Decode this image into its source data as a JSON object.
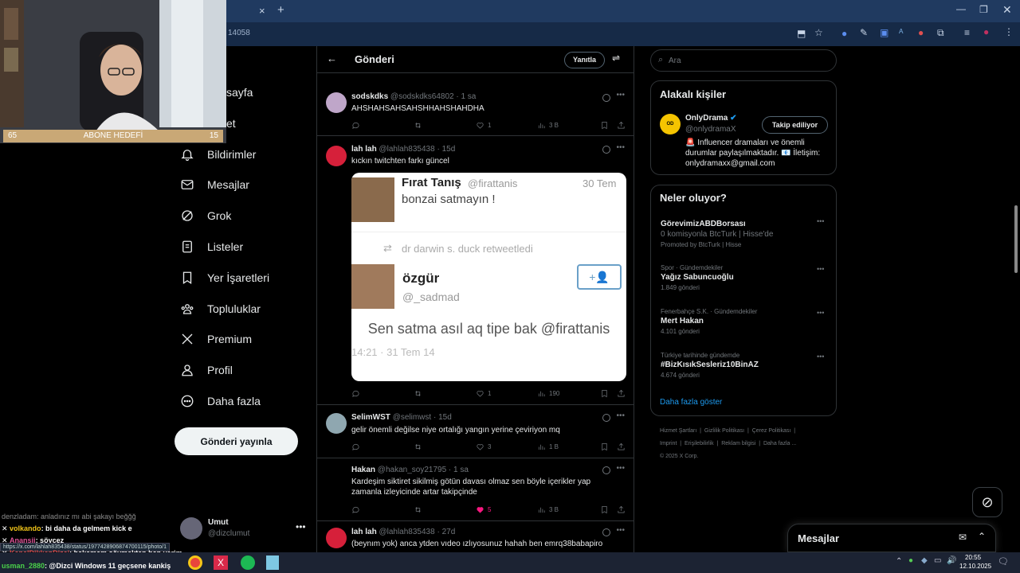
{
  "browser": {
    "url_fragment": "14058",
    "new_tab_symbol": "+",
    "close_symbol": "×"
  },
  "stream": {
    "goal_left": "65",
    "goal_label": "ABONE HEDEFİ",
    "goal_right": "15"
  },
  "sidebar": {
    "items": [
      {
        "label": "sayfa",
        "icon": "home-icon"
      },
      {
        "label": "et",
        "icon": "search-icon"
      },
      {
        "label": "Bildirimler",
        "icon": "bell-icon"
      },
      {
        "label": "Mesajlar",
        "icon": "mail-icon"
      },
      {
        "label": "Grok",
        "icon": "grok-icon"
      },
      {
        "label": "Listeler",
        "icon": "list-icon"
      },
      {
        "label": "Yer İşaretleri",
        "icon": "bookmark-icon"
      },
      {
        "label": "Topluluklar",
        "icon": "communities-icon"
      },
      {
        "label": "Premium",
        "icon": "x-logo-icon"
      },
      {
        "label": "Profil",
        "icon": "profile-icon"
      },
      {
        "label": "Daha fazla",
        "icon": "more-circle-icon"
      }
    ],
    "post_button": "Gönderi yayınla",
    "account_name": "Umut",
    "account_handle": "@dizclumut"
  },
  "header": {
    "title": "Gönderi",
    "reply_button": "Yanıtla"
  },
  "tweets": [
    {
      "name": "sodskdks",
      "handle": "@sodskdks64802",
      "time": "· 1 sa",
      "text": "AHSHAHSAHSAHSHHAHSHAHDHA",
      "likes": "1",
      "views": "3 B",
      "replies": "",
      "retweets": ""
    },
    {
      "name": "lah lah",
      "handle": "@lahlah835438",
      "time": "· 15d",
      "text": "kıckın twitchten farkı güncel",
      "likes": "1",
      "views": "190",
      "embed": {
        "name1": "Fırat Tanış",
        "handle1": "@firattanis",
        "date1": "30 Tem",
        "text1": "bonzai satmayın !",
        "retweet_line": "dr darwin s. duck retweetledi",
        "name2": "özgür",
        "handle2": "@_sadmad",
        "text2": "Sen satma asıl aq tipe bak @firattanis",
        "timestamp": "14:21 · 31 Tem 14"
      }
    },
    {
      "name": "SelimWST",
      "handle": "@selimwst",
      "time": "· 15d",
      "text": "gelir önemli değilse niye ortalığı yangın yerine çeviriyon mq",
      "likes": "3",
      "views": "1 B"
    },
    {
      "name": "Hakan",
      "handle": "@hakan_soy21795",
      "time": "· 1 sa",
      "text": "Kardeşim siktiret sikilmiş götün davası olmaz sen böyle içerikler yap zamanla izleyicinde artar takipçinde",
      "likes": "5",
      "views": "3 B"
    },
    {
      "name": "lah lah",
      "handle": "@lahlah835438",
      "time": "· 27d",
      "text": "(beynım yok) anca ytden  vıdeo ızlıyosunuz hahah ben emrq38babapiro"
    }
  ],
  "search": {
    "placeholder": "Ara"
  },
  "related": {
    "title": "Alakalı kişiler",
    "name": "OnlyDrama",
    "handle": "@onlydramaX",
    "follow_button": "Takip ediliyor",
    "bio": "🚨 Influencer dramaları ve önemli durumlar paylaşılmaktadır. 📧 İletişim: onlydramaxx@gmail.com"
  },
  "trends": {
    "title": "Neler oluyor?",
    "items": [
      {
        "meta": "",
        "title": "GörevimizABDBorsası",
        "sub": "0 komisyonla BtcTurk | Hisse'de",
        "count": "Promoted by BtcTurk | Hisse"
      },
      {
        "meta": "Spor · Gündemdekiler",
        "title": "Yağız Sabuncuoğlu",
        "sub": "",
        "count": "1.849 gönderi"
      },
      {
        "meta": "Fenerbahçe S.K. · Gündemdekiler",
        "title": "Mert Hakan",
        "sub": "",
        "count": "4.101 gönderi"
      },
      {
        "meta": "Türkiye tarihinde gündemde",
        "title": "#BizKısıkSesleriz10BinAZ",
        "sub": "",
        "count": "4.674 gönderi"
      }
    ],
    "show_more": "Daha fazla göster"
  },
  "footer": {
    "links": [
      "Hizmet Şartları",
      "Gizlilik Politikası",
      "Çerez Politikası",
      "Imprint",
      "Erişilebilirlik",
      "Reklam bilgisi",
      "Daha fazla ..."
    ],
    "copyright": "© 2025 X Corp."
  },
  "messages_dock": {
    "title": "Mesajlar"
  },
  "chat": [
    {
      "user": "denzladam",
      "text": ": anladınız mı abi şakayı beğğğ",
      "color": "#8a8a8a"
    },
    {
      "user": "volkando",
      "text": ": bi daha da gelmem kick e",
      "color": "#f0c419"
    },
    {
      "user": "Anansii",
      "text": ": söycez",
      "color": "#e0559a"
    },
    {
      "user": "KanalDikkenDizci",
      "text": ": bakamam sövmekten ban yerim",
      "color": "#e04a4a"
    },
    {
      "user": "usman_2880",
      "text": ": @Dizci Windows 11 geçsene kankiş",
      "color": "#4ad14a"
    }
  ],
  "status_url": "https://x.com/lahlah835438/status/1977428906874700115/photo/1",
  "taskbar": {
    "time": "20:55",
    "date": "12.10.2025"
  }
}
